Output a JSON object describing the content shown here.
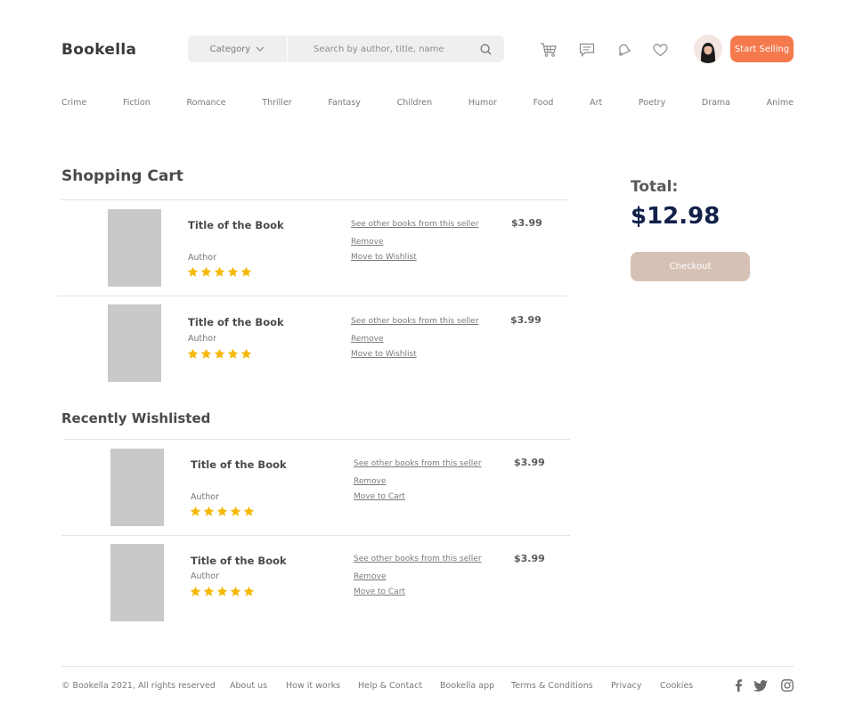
{
  "header": {
    "brand": "Bookella",
    "category_label": "Category",
    "search_placeholder": "Search by author, title, name",
    "start_selling_label": "Start Selling"
  },
  "categories": [
    "Crime",
    "Fiction",
    "Romance",
    "Thriller",
    "Fantasy",
    "Children",
    "Humor",
    "Food",
    "Art",
    "Poetry",
    "Drama",
    "Anime"
  ],
  "cart": {
    "title": "Shopping Cart",
    "items": [
      {
        "title": "Title of the Book",
        "author": "Author",
        "rating": 5,
        "link_seller": "See other books from this seller",
        "link_remove": "Remove",
        "link_move": "Move to Wishlist",
        "price": "$3.99"
      },
      {
        "title": "Title of the Book",
        "author": "Author",
        "rating": 5,
        "link_seller": "See other books from this seller",
        "link_remove": "Remove",
        "link_move": "Move to Wishlist",
        "price": "$3.99"
      }
    ]
  },
  "wishlist": {
    "title": "Recently Wishlisted",
    "items": [
      {
        "title": "Title of the Book",
        "author": "Author",
        "rating": 5,
        "link_seller": "See other books from this seller",
        "link_remove": "Remove",
        "link_move": "Move to Cart",
        "price": "$3.99"
      },
      {
        "title": "Title of the Book",
        "author": "Author",
        "rating": 5,
        "link_seller": "See other books from this seller",
        "link_remove": "Remove",
        "link_move": "Move to Cart",
        "price": "$3.99"
      }
    ]
  },
  "summary": {
    "total_label": "Total:",
    "total_value": "$12.98",
    "checkout_label": "Checkout"
  },
  "footer": {
    "copyright": "© Bookella 2021, All rights reserved",
    "links": [
      "About us",
      "How it works",
      "Help & Contact",
      "Bookella app",
      "Terms & Conditions",
      "Privacy",
      "Cookies"
    ]
  },
  "colors": {
    "accent": "#f47a4d",
    "star": "#f5b90a",
    "total": "#12214a",
    "checkout": "#d6c2b5",
    "cover_placeholder": "#c9c9c9"
  },
  "icons": [
    "chevron-down-icon",
    "search-icon",
    "cart-icon",
    "message-icon",
    "bell-icon",
    "heart-icon",
    "star-icon",
    "facebook-icon",
    "twitter-icon",
    "instagram-icon"
  ]
}
